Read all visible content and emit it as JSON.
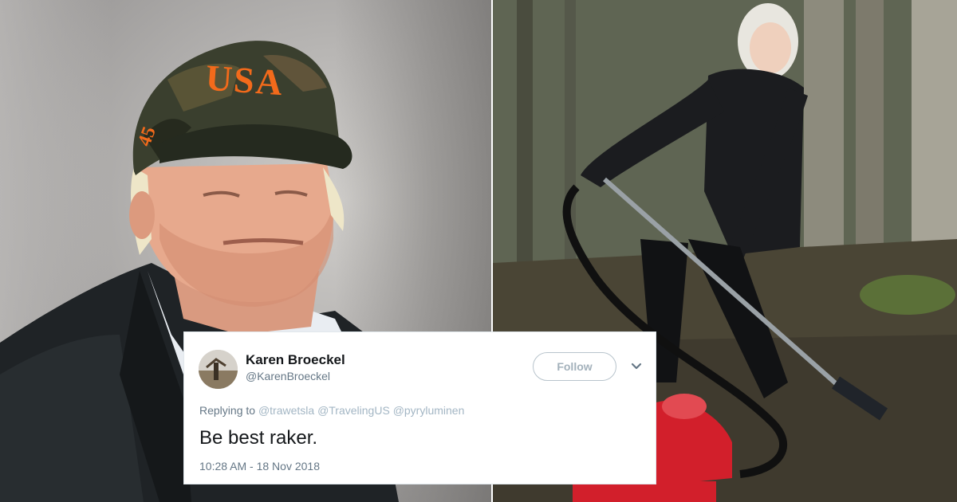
{
  "tweet": {
    "display_name": "Karen Broeckel",
    "handle": "@KarenBroeckel",
    "follow_label": "Follow",
    "replying_prefix": "Replying to",
    "replying_to": [
      "@trawetsla",
      "@TravelingUS",
      "@pyryluminen"
    ],
    "text": "Be best raker.",
    "timestamp": "10:28 AM - 18 Nov 2018"
  },
  "photo_left": {
    "cap_text": "USA",
    "cap_side_number": "45"
  },
  "colors": {
    "tweet_text": "#14171a",
    "muted": "#657786",
    "follow_border": "#b8c4cc",
    "cap_lettering": "#f26a1b"
  },
  "icons": {
    "more": "chevron-down-icon",
    "avatar": "avatar"
  }
}
